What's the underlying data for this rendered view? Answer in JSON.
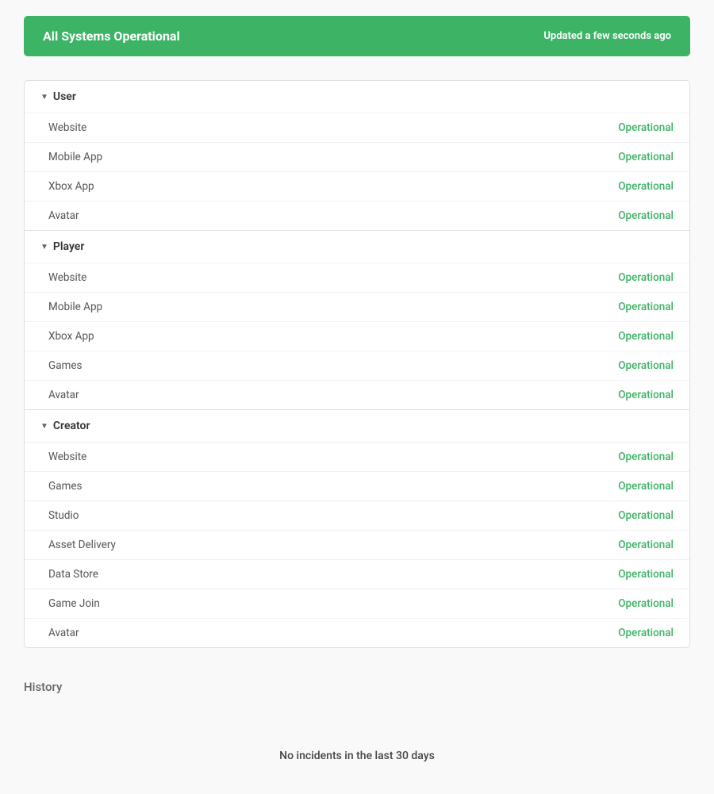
{
  "banner": {
    "title": "All Systems Operational",
    "updated": "Updated a few seconds ago",
    "color": "#3db366"
  },
  "sections": [
    {
      "id": "user",
      "label": "User",
      "items": [
        {
          "name": "Website",
          "status": "Operational"
        },
        {
          "name": "Mobile App",
          "status": "Operational"
        },
        {
          "name": "Xbox App",
          "status": "Operational"
        },
        {
          "name": "Avatar",
          "status": "Operational"
        }
      ]
    },
    {
      "id": "player",
      "label": "Player",
      "items": [
        {
          "name": "Website",
          "status": "Operational"
        },
        {
          "name": "Mobile App",
          "status": "Operational"
        },
        {
          "name": "Xbox App",
          "status": "Operational"
        },
        {
          "name": "Games",
          "status": "Operational"
        },
        {
          "name": "Avatar",
          "status": "Operational"
        }
      ]
    },
    {
      "id": "creator",
      "label": "Creator",
      "items": [
        {
          "name": "Website",
          "status": "Operational"
        },
        {
          "name": "Games",
          "status": "Operational"
        },
        {
          "name": "Studio",
          "status": "Operational"
        },
        {
          "name": "Asset Delivery",
          "status": "Operational"
        },
        {
          "name": "Data Store",
          "status": "Operational"
        },
        {
          "name": "Game Join",
          "status": "Operational"
        },
        {
          "name": "Avatar",
          "status": "Operational"
        }
      ]
    }
  ],
  "history": {
    "title": "History",
    "no_incidents": "No incidents in the last 30 days"
  }
}
